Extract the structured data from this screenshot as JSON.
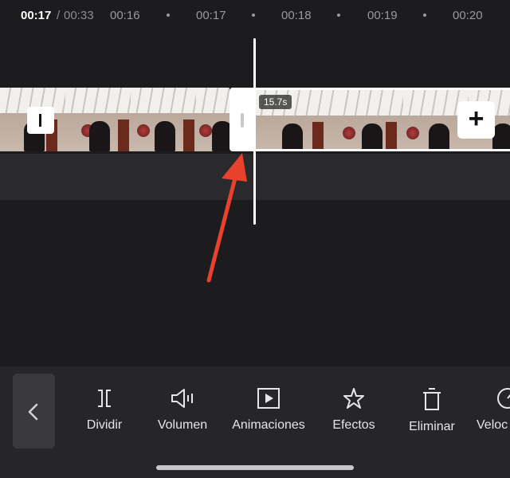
{
  "ruler": {
    "current_time": "00:17",
    "separator": "/",
    "total_time": "00:33",
    "ticks": [
      "00:16",
      "00:17",
      "00:18",
      "00:19",
      "00:20"
    ]
  },
  "clip": {
    "duration_badge": "15.7s",
    "add_symbol": "+"
  },
  "toolbar": {
    "back_icon": "chevron-left-icon",
    "tools": [
      {
        "label": "Dividir",
        "icon": "split-icon"
      },
      {
        "label": "Volumen",
        "icon": "volume-icon"
      },
      {
        "label": "Animaciones",
        "icon": "animation-icon"
      },
      {
        "label": "Efectos",
        "icon": "effects-icon"
      },
      {
        "label": "Eliminar",
        "icon": "delete-icon"
      },
      {
        "label": "Veloc",
        "icon": "speed-icon"
      }
    ]
  },
  "colors": {
    "background": "#1c1c1e",
    "toolbar": "#262628",
    "annotation_arrow": "#e8412c",
    "playhead": "#ffffff"
  }
}
